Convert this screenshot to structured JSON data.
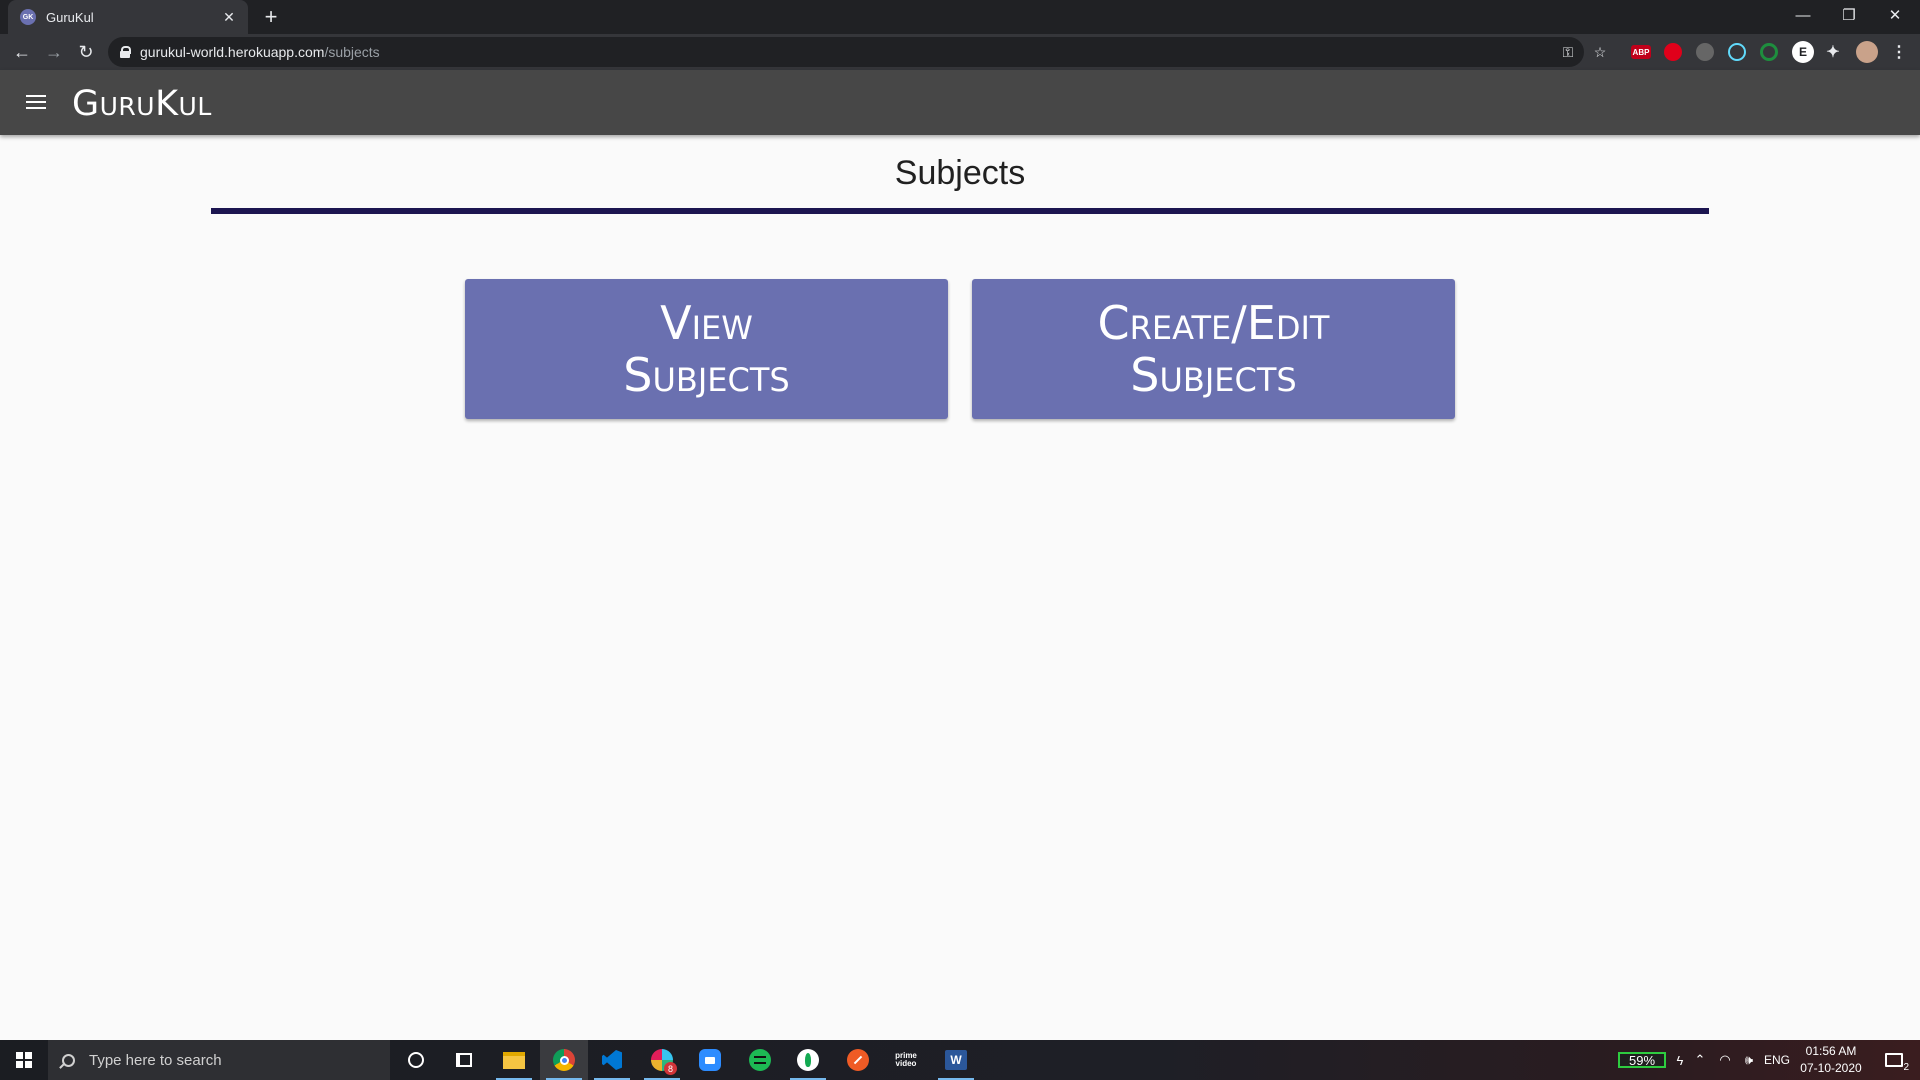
{
  "browser": {
    "tab_title": "GuruKul",
    "tab_favicon_text": "GK",
    "url_host": "gurukul-world.herokuapp.com",
    "url_path": "/subjects",
    "extensions": [
      {
        "name": "adblock-plus",
        "label": "ABP",
        "color": "#c0001a"
      },
      {
        "name": "red-extension",
        "label": "",
        "color": "#e0001a"
      },
      {
        "name": "gray-extension",
        "label": "",
        "color": "#666666"
      },
      {
        "name": "react-devtools",
        "label": "",
        "color": "#3d5a80"
      },
      {
        "name": "green-extension",
        "label": "",
        "color": "#1e8e3e"
      },
      {
        "name": "e-extension",
        "label": "E",
        "color": "#ffffff"
      }
    ]
  },
  "app": {
    "brand": "GuruKul",
    "accent_color": "#6a70b0",
    "rule_color": "#1c1550"
  },
  "main": {
    "title": "Subjects",
    "buttons": [
      {
        "line1": "View",
        "line2": "Subjects"
      },
      {
        "line1": "Create/Edit",
        "line2": "Subjects"
      }
    ]
  },
  "taskbar": {
    "search_placeholder": "Type here to search",
    "apps": [
      "cortana-icon",
      "task-view-icon",
      "file-explorer-icon",
      "chrome-icon",
      "vscode-icon",
      "slack-icon",
      "zoom-icon",
      "spotify-icon",
      "mongodb-icon",
      "postman-icon",
      "prime-video-icon",
      "word-icon"
    ],
    "slack_badge": "8",
    "prime_label_1": "prime",
    "prime_label_2": "video",
    "battery": "59%",
    "language": "ENG",
    "time": "01:56 AM",
    "date": "07-10-2020",
    "notifications": "2"
  }
}
